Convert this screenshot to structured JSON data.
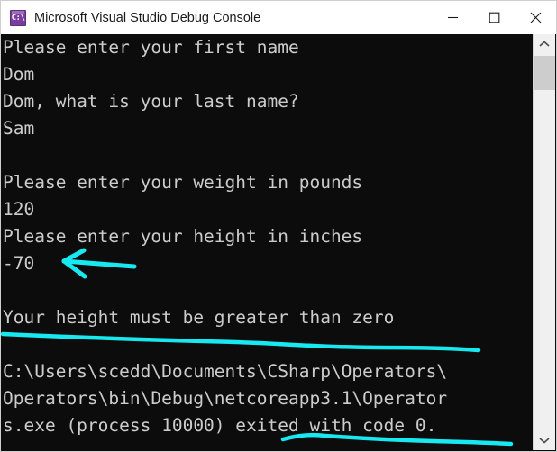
{
  "window": {
    "title": "Microsoft Visual Studio Debug Console",
    "icon_name": "console-app-icon",
    "icon_glyph": "C:\\",
    "controls": {
      "minimize_label": "Minimize",
      "maximize_label": "Maximize",
      "close_label": "Close"
    }
  },
  "console": {
    "background_color": "#0c0c0c",
    "text_color": "#cccccc",
    "lines": [
      "Please enter your first name",
      "Dom",
      "Dom, what is your last name?",
      "Sam",
      "",
      "Please enter your weight in pounds",
      "120",
      "Please enter your height in inches",
      "-70",
      "",
      "Your height must be greater than zero",
      "",
      "C:\\Users\\scedd\\Documents\\CSharp\\Operators\\",
      "Operators\\bin\\Debug\\netcoreapp3.1\\Operator",
      "s.exe (process 10000) exited with code 0."
    ]
  },
  "scrollbar": {
    "up_arrow_label": "Scroll up",
    "down_arrow_label": "Scroll down",
    "thumb_label": "Scroll thumb",
    "track_color": "#f0f0f0",
    "thumb_color": "#cdcdcd"
  },
  "annotations": {
    "color": "#18E8F0",
    "items": [
      {
        "name": "arrow-pointing-at-height-input",
        "kind": "arrow",
        "target_text": "-70"
      },
      {
        "name": "underline-error-message",
        "kind": "underline",
        "target_text": "Your height must be greater than zero"
      },
      {
        "name": "underline-exit-code",
        "kind": "underline",
        "target_text": "exited with code 0."
      }
    ]
  }
}
